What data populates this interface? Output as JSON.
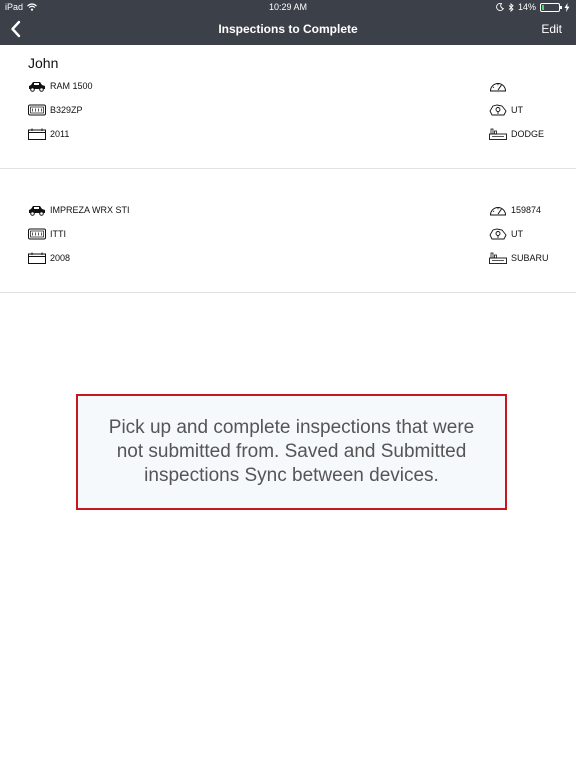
{
  "status_bar": {
    "device": "iPad",
    "time": "10:29 AM",
    "battery_percent": "14%",
    "battery_level": 0.14
  },
  "nav": {
    "title": "Inspections to Complete",
    "edit_label": "Edit"
  },
  "inspections": [
    {
      "owner": "John",
      "model": "RAM 1500",
      "plate": "B329ZP",
      "year": "2011",
      "mileage": "",
      "state": "UT",
      "make": "DODGE"
    },
    {
      "owner": "",
      "model": "IMPREZA WRX STI",
      "plate": "ITTI",
      "year": "2008",
      "mileage": "159874",
      "state": "UT",
      "make": "SUBARU"
    }
  ],
  "info_message": "Pick up and complete inspections that were not submitted from. Saved and Submitted inspections Sync between devices.",
  "colors": {
    "nav_background": "#3c4048",
    "info_border": "#c4171e",
    "info_background": "#f5f9fc",
    "battery_fill": "#4cd964"
  }
}
